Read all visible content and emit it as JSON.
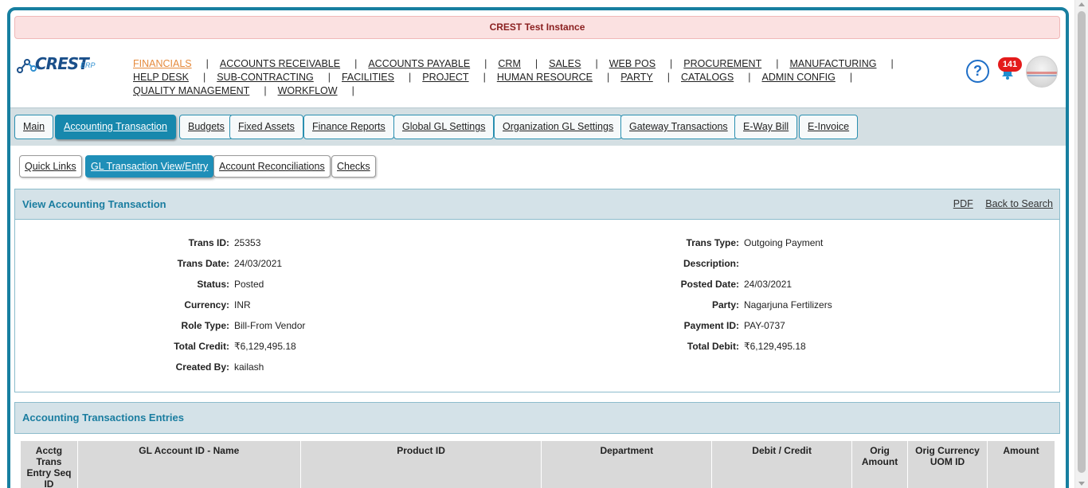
{
  "banner": {
    "title": "CREST Test Instance"
  },
  "logo": {
    "text": "CREST",
    "suffix": "ERP"
  },
  "topnav": {
    "line1": [
      "FINANCIALS",
      "ACCOUNTS RECEIVABLE",
      "ACCOUNTS PAYABLE",
      "CRM",
      "SALES",
      "WEB POS",
      "PROCUREMENT",
      "MANUFACTURING"
    ],
    "line2": [
      "HELP DESK",
      "SUB-CONTRACTING",
      "FACILITIES",
      "PROJECT",
      "HUMAN RESOURCE",
      "PARTY",
      "CATALOGS",
      "ADMIN CONFIG"
    ],
    "line3": [
      "QUALITY MANAGEMENT",
      "WORKFLOW"
    ],
    "active": "FINANCIALS",
    "separator": "|"
  },
  "header_icons": {
    "help": "?",
    "notification_count": "141",
    "help_icon": "question-circle-icon",
    "bell_icon": "bell-icon"
  },
  "tabs": [
    "Main",
    "Accounting Transaction",
    "Budgets",
    "Fixed Assets",
    "Finance Reports",
    "Global GL Settings",
    "Organization GL Settings",
    "Gateway Transactions",
    "E-Way Bill",
    "E-Invoice"
  ],
  "active_tab": "Accounting Transaction",
  "subtabs": [
    "Quick Links",
    "GL Transaction View/Entry",
    "Account Reconciliations",
    "Checks"
  ],
  "active_subtab": "GL Transaction View/Entry",
  "view_panel": {
    "title": "View Accounting Transaction",
    "pdf_link": "PDF",
    "back_link": "Back to Search",
    "left_fields": [
      {
        "label": "Trans ID:",
        "value": "25353"
      },
      {
        "label": "Trans Date:",
        "value": "24/03/2021"
      },
      {
        "label": "Status:",
        "value": "Posted"
      },
      {
        "label": "Currency:",
        "value": "INR"
      },
      {
        "label": "Role Type:",
        "value": "Bill-From Vendor"
      },
      {
        "label": "Total Credit:",
        "value": "₹6,129,495.18"
      },
      {
        "label": "Created By:",
        "value": "kailash"
      }
    ],
    "right_fields": [
      {
        "label": "Trans Type:",
        "value": "Outgoing Payment"
      },
      {
        "label": "Description:",
        "value": ""
      },
      {
        "label": "Posted Date:",
        "value": "24/03/2021"
      },
      {
        "label": "Party:",
        "value": "Nagarjuna Fertilizers"
      },
      {
        "label": "Payment ID:",
        "value": "PAY-0737"
      },
      {
        "label": "Total Debit:",
        "value": "₹6,129,495.18"
      }
    ]
  },
  "entries_panel": {
    "title": "Accounting Transactions Entries",
    "columns": [
      "Acctg Trans Entry Seq ID",
      "GL Account ID - Name",
      "Product ID",
      "Department",
      "Debit / Credit",
      "Orig Amount",
      "Orig Currency UOM ID",
      "Amount"
    ]
  },
  "colors": {
    "brand": "#177fa0",
    "active_tab": "#1788ad",
    "active_menu": "#e58a3c",
    "badge": "#e41b1b"
  }
}
